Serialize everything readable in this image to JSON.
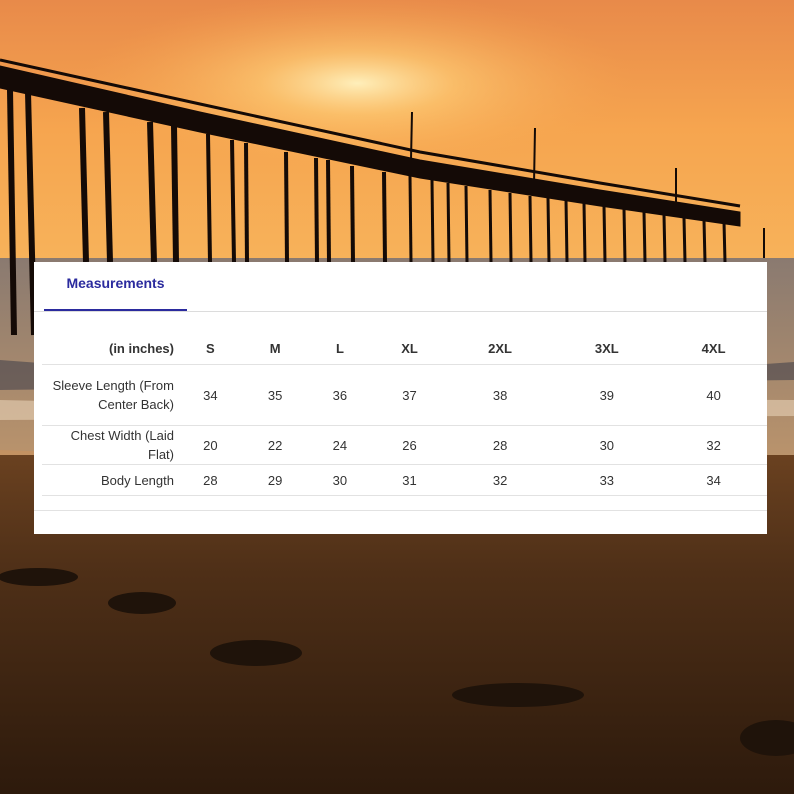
{
  "tab": {
    "label": "Measurements"
  },
  "table": {
    "unit_header": "(in inches)",
    "sizes": [
      "S",
      "M",
      "L",
      "XL",
      "2XL",
      "3XL",
      "4XL"
    ],
    "rows": [
      {
        "label": "Sleeve Length (From Center Back)",
        "values": [
          "34",
          "35",
          "36",
          "37",
          "38",
          "39",
          "40"
        ]
      },
      {
        "label": "Chest Width (Laid Flat)",
        "values": [
          "20",
          "22",
          "24",
          "26",
          "28",
          "30",
          "32"
        ]
      },
      {
        "label": "Body Length",
        "values": [
          "28",
          "29",
          "30",
          "31",
          "32",
          "33",
          "34"
        ]
      }
    ]
  },
  "colors": {
    "accent": "#2b2b9e",
    "sky_top": "#e88a4a",
    "sun": "#fff3c0",
    "sand": "#3a2412"
  }
}
